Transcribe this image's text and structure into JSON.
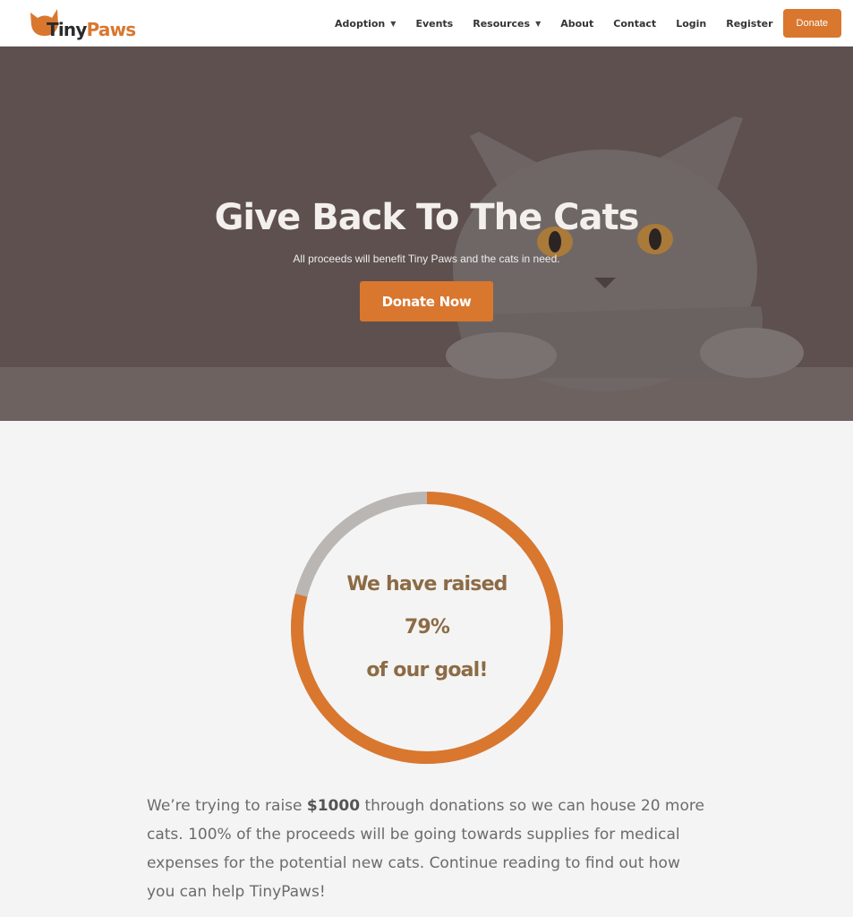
{
  "nav": {
    "logo": {
      "part1": "Tiny",
      "part2": "Paws"
    },
    "items": [
      {
        "label": "Adoption",
        "dropdown": true
      },
      {
        "label": "Events",
        "dropdown": false
      },
      {
        "label": "Resources",
        "dropdown": true
      },
      {
        "label": "About",
        "dropdown": false
      },
      {
        "label": "Contact",
        "dropdown": false
      },
      {
        "label": "Login",
        "dropdown": false
      },
      {
        "label": "Register",
        "dropdown": false
      }
    ],
    "donate_label": "Donate"
  },
  "hero": {
    "title": "Give Back To The Cats",
    "subtitle": "All proceeds will benefit Tiny Paws and the cats in need.",
    "cta_label": "Donate Now"
  },
  "progress": {
    "line1": "We have raised",
    "percent_label": "79%",
    "line3": "of our goal!",
    "value": 0.79
  },
  "body": {
    "intro": "We’re trying to raise ",
    "amount": "$1000",
    "rest": " through donations so we can house 20 more cats. 100% of the proceeds will be going towards supplies for medical expenses for the potential new cats. Continue reading to find out how you can help TinyPaws!"
  },
  "colors": {
    "accent": "#d9772f",
    "track": "#b9b6b4",
    "progress_text": "#8c6b45",
    "hero_overlay": "#5d504e"
  }
}
